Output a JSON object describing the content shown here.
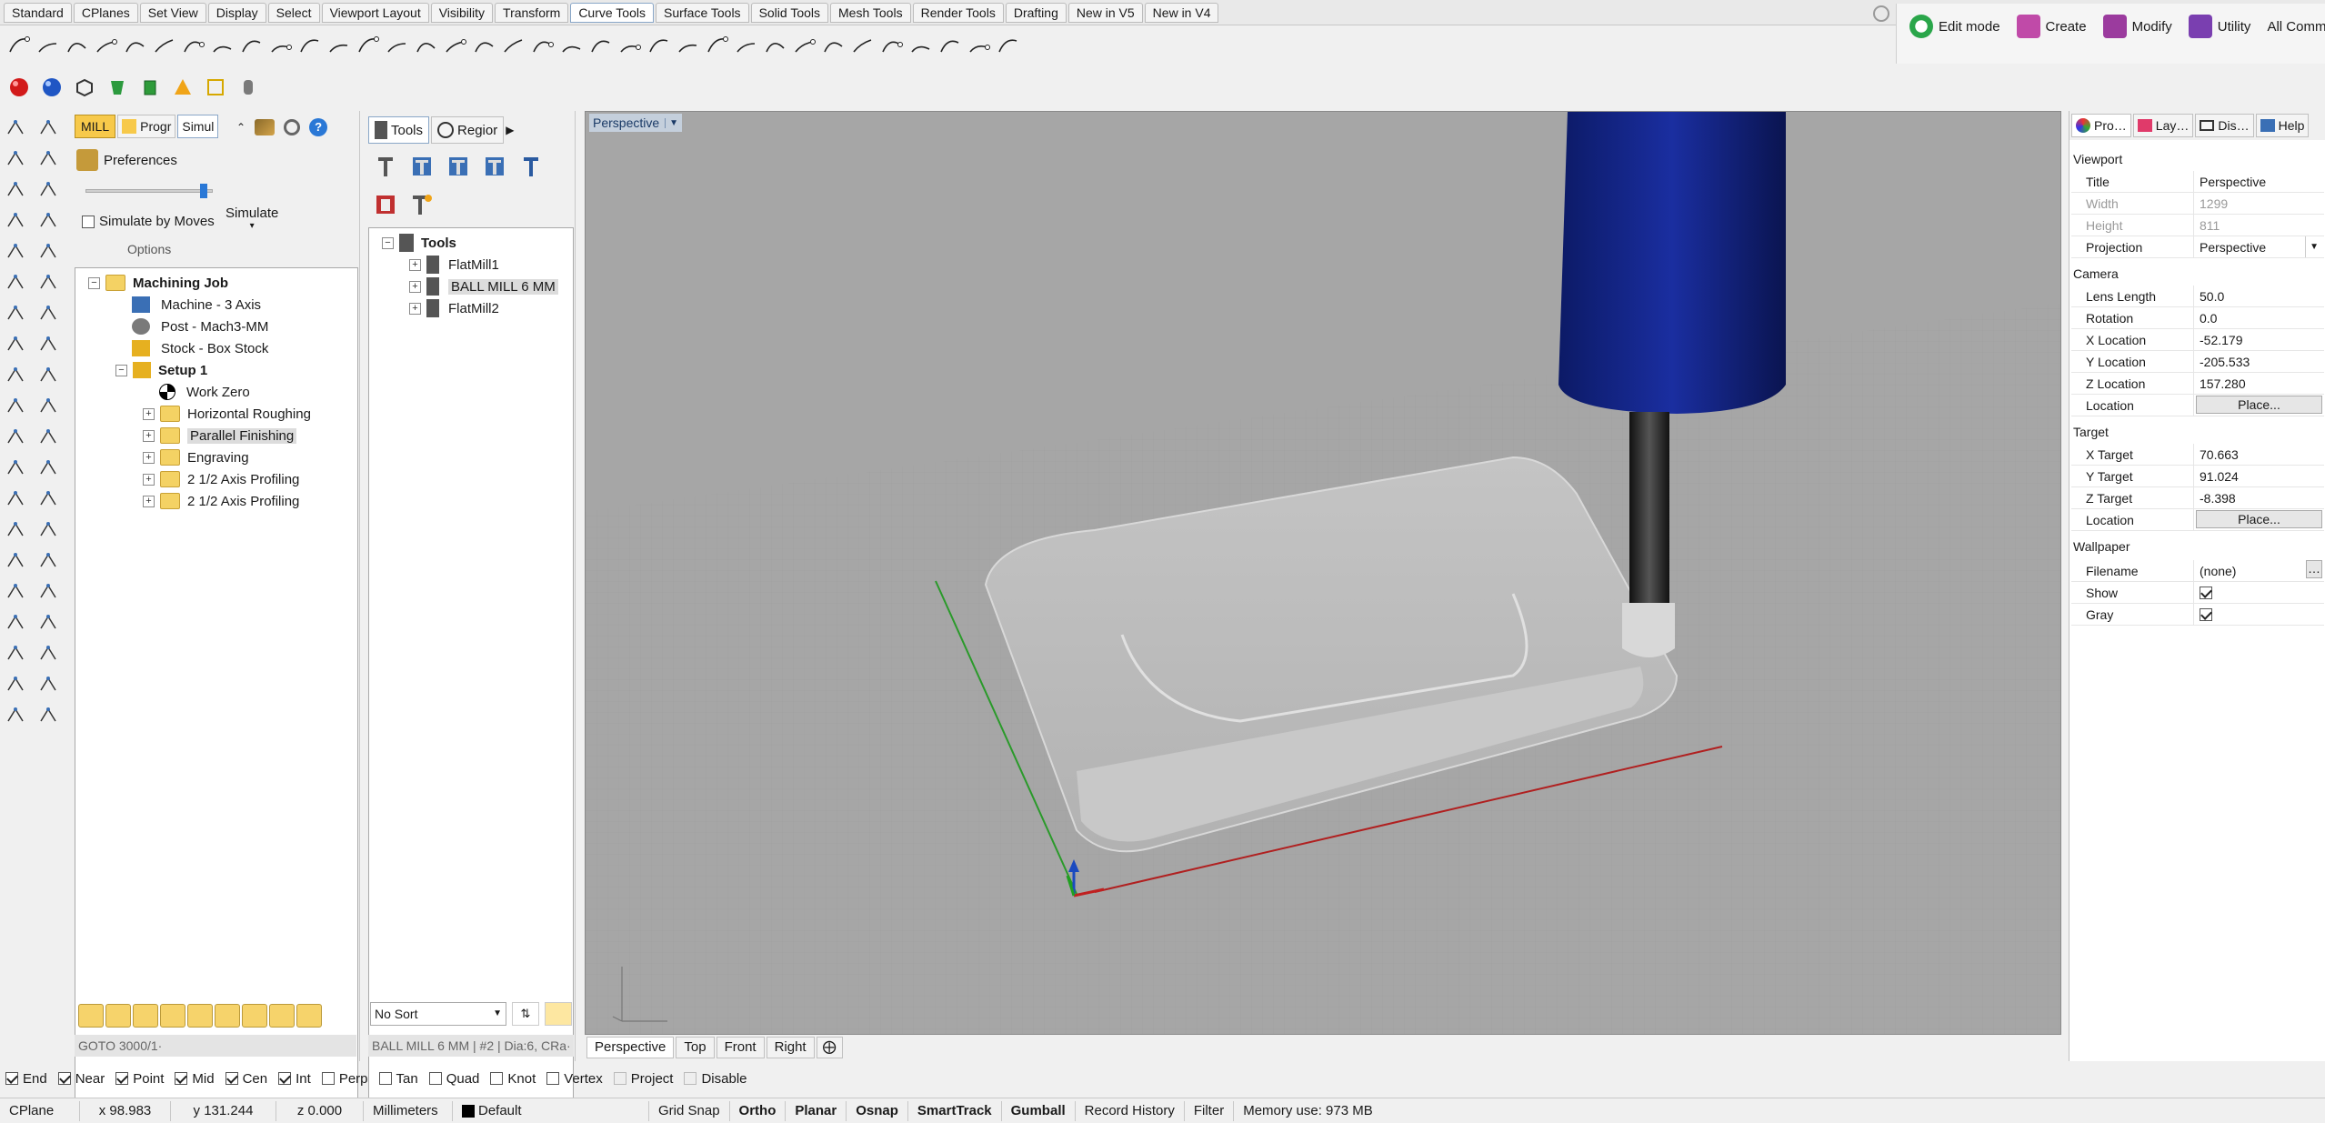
{
  "ribbon_tabs": [
    "Standard",
    "CPlanes",
    "Set View",
    "Display",
    "Select",
    "Viewport Layout",
    "Visibility",
    "Transform",
    "Curve Tools",
    "Surface Tools",
    "Solid Tools",
    "Mesh Tools",
    "Render Tools",
    "Drafting",
    "New in V5",
    "New in V4"
  ],
  "ribbon_active": "Curve Tools",
  "commands": {
    "edit_mode": "Edit mode",
    "create": "Create",
    "modify": "Modify",
    "utility": "Utility",
    "all_commands": "All Command"
  },
  "mill_panel": {
    "tabs": [
      "MILL",
      "Progr",
      "Simul"
    ],
    "preferences": "Preferences",
    "simulate_by_moves": "Simulate by Moves",
    "simulate": "Simulate",
    "options": "Options",
    "tree": {
      "root": "Machining Job",
      "machine": "Machine - 3 Axis",
      "post": "Post - Mach3-MM",
      "stock": "Stock - Box Stock",
      "setup": "Setup 1",
      "work_zero": "Work Zero",
      "ops": [
        "Horizontal Roughing",
        "Parallel Finishing",
        "Engraving",
        "2 1/2 Axis Profiling",
        "2 1/2 Axis Profiling"
      ]
    },
    "status": "GOTO 3000/1·"
  },
  "tools_panel": {
    "tabs": [
      "Tools",
      "Regior"
    ],
    "tree_root": "Tools",
    "items": [
      "FlatMill1",
      "BALL MILL 6 MM",
      "FlatMill2"
    ],
    "sort": "No Sort",
    "status": "BALL MILL 6 MM | #2 | Dia:6, CRa·"
  },
  "viewport": {
    "title": "Perspective",
    "tabs": [
      "Perspective",
      "Top",
      "Front",
      "Right"
    ]
  },
  "properties": {
    "tabs": [
      "Pro…",
      "Lay…",
      "Dis…",
      "Help"
    ],
    "viewport_section": "Viewport",
    "title_label": "Title",
    "title": "Perspective",
    "width_label": "Width",
    "width": "1299",
    "height_label": "Height",
    "height": "811",
    "projection_label": "Projection",
    "projection": "Perspective",
    "camera_section": "Camera",
    "lens_label": "Lens Length",
    "lens": "50.0",
    "rotation_label": "Rotation",
    "rotation": "0.0",
    "xloc_label": "X Location",
    "xloc": "-52.179",
    "yloc_label": "Y Location",
    "yloc": "-205.533",
    "zloc_label": "Z Location",
    "zloc": "157.280",
    "location_label": "Location",
    "place": "Place...",
    "target_section": "Target",
    "xt_label": "X Target",
    "xt": "70.663",
    "yt_label": "Y Target",
    "yt": "91.024",
    "zt_label": "Z Target",
    "zt": "-8.398",
    "wallpaper_section": "Wallpaper",
    "filename_label": "Filename",
    "filename": "(none)",
    "show_label": "Show",
    "gray_label": "Gray"
  },
  "osnaps": [
    {
      "label": "End",
      "on": true
    },
    {
      "label": "Near",
      "on": true
    },
    {
      "label": "Point",
      "on": true
    },
    {
      "label": "Mid",
      "on": true
    },
    {
      "label": "Cen",
      "on": true
    },
    {
      "label": "Int",
      "on": true
    },
    {
      "label": "Perp",
      "on": false
    },
    {
      "label": "Tan",
      "on": false
    },
    {
      "label": "Quad",
      "on": false
    },
    {
      "label": "Knot",
      "on": false
    },
    {
      "label": "Vertex",
      "on": false
    },
    {
      "label": "Project",
      "on": false
    },
    {
      "label": "Disable",
      "on": false
    }
  ],
  "status": {
    "cplane": "CPlane",
    "x": "x 98.983",
    "y": "y 131.244",
    "z": "z 0.000",
    "units": "Millimeters",
    "layer": "Default",
    "grid_snap": "Grid Snap",
    "ortho": "Ortho",
    "planar": "Planar",
    "osnap": "Osnap",
    "smarttrack": "SmartTrack",
    "gumball": "Gumball",
    "record_history": "Record History",
    "filter": "Filter",
    "memory": "Memory use: 973 MB"
  }
}
